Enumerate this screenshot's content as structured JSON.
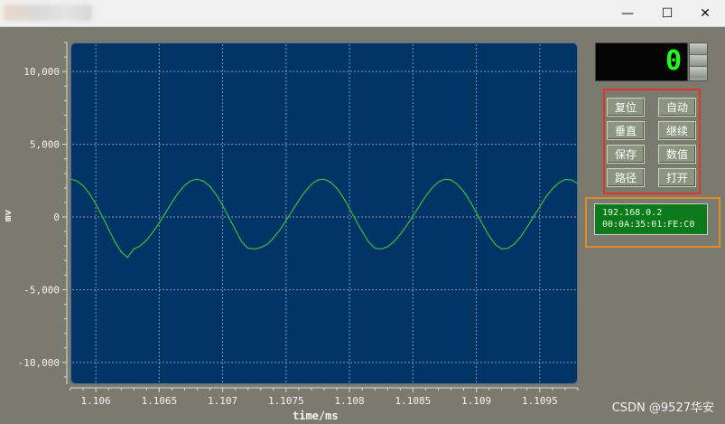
{
  "window": {
    "minimize_glyph": "—",
    "maximize_glyph": "☐",
    "close_glyph": "✕"
  },
  "chart_data": {
    "type": "line",
    "title": "",
    "xlabel": "time/ms",
    "ylabel": "mv",
    "xlim": [
      1.1058,
      1.1098
    ],
    "ylim": [
      -11500,
      12000
    ],
    "xticks": [
      "1.106",
      "1.1065",
      "1.107",
      "1.1075",
      "1.108",
      "1.1085",
      "1.109",
      "1.1095"
    ],
    "xtick_values": [
      1.106,
      1.1065,
      1.107,
      1.1075,
      1.108,
      1.1085,
      1.109,
      1.1095
    ],
    "yticks": [
      "10,000",
      "5,000",
      "0",
      "-5,000",
      "-10,000"
    ],
    "ytick_values": [
      10000,
      5000,
      0,
      -5000,
      -10000
    ],
    "grid": true,
    "series": [
      {
        "name": "",
        "color": "#2fc23a",
        "x": [
          1.1058,
          1.10585,
          1.1059,
          1.10595,
          1.106,
          1.10605,
          1.1061,
          1.10615,
          1.1062,
          1.10625,
          1.1063,
          1.10635,
          1.1064,
          1.10645,
          1.1065,
          1.10655,
          1.1066,
          1.10665,
          1.1067,
          1.10675,
          1.1068,
          1.10685,
          1.1069,
          1.10695,
          1.107,
          1.10705,
          1.1071,
          1.10715,
          1.1072,
          1.10725,
          1.1073,
          1.10735,
          1.1074,
          1.10745,
          1.1075,
          1.10755,
          1.1076,
          1.10765,
          1.1077,
          1.10775,
          1.1078,
          1.10785,
          1.1079,
          1.10795,
          1.108,
          1.10805,
          1.1081,
          1.10815,
          1.1082,
          1.10825,
          1.1083,
          1.10835,
          1.1084,
          1.10845,
          1.1085,
          1.10855,
          1.1086,
          1.10865,
          1.1087,
          1.10875,
          1.1088,
          1.10885,
          1.1089,
          1.10895,
          1.109,
          1.10905,
          1.1091,
          1.10915,
          1.1092,
          1.10925,
          1.1093,
          1.10935,
          1.1094,
          1.10945,
          1.1095,
          1.10955,
          1.1096,
          1.10965,
          1.1097,
          1.10975,
          1.1098
        ],
        "y": [
          2600,
          2485,
          2146,
          1607,
          900,
          70,
          -832,
          -1701,
          -2400,
          -2783,
          -2200,
          -1990,
          -1594,
          -1050,
          -400,
          300,
          1000,
          1650,
          2172,
          2500,
          2600,
          2470,
          2100,
          1530,
          800,
          -30,
          -880,
          -1700,
          -2150,
          -2200,
          -2100,
          -1880,
          -1450,
          -900,
          -250,
          450,
          1130,
          1750,
          2250,
          2550,
          2600,
          2400,
          1980,
          1350,
          600,
          -220,
          -1000,
          -1700,
          -2150,
          -2200,
          -2050,
          -1700,
          -1200,
          -600,
          70,
          760,
          1420,
          1990,
          2400,
          2600,
          2550,
          2250,
          1750,
          1080,
          300,
          -520,
          -1300,
          -1900,
          -2200,
          -2150,
          -1850,
          -1350,
          -700,
          0,
          700,
          1400,
          1950,
          2350,
          2580,
          2550,
          2300
        ]
      }
    ]
  },
  "lcd": {
    "value": "0"
  },
  "buttons": [
    {
      "label": "复位"
    },
    {
      "label": "自动"
    },
    {
      "label": "垂直"
    },
    {
      "label": "继续"
    },
    {
      "label": "保存"
    },
    {
      "label": "数值"
    },
    {
      "label": "路径"
    },
    {
      "label": "打开"
    }
  ],
  "network": {
    "ip": "192.168.0.2",
    "mac": "00:0A:35:01:FE:C0"
  },
  "watermark": "CSDN @9527华安",
  "colors": {
    "background": "#7a7a6e",
    "plot_bg": "#003366",
    "trace": "#2fc23a",
    "highlight_red": "#e0352f",
    "highlight_orange": "#e08b2a"
  }
}
